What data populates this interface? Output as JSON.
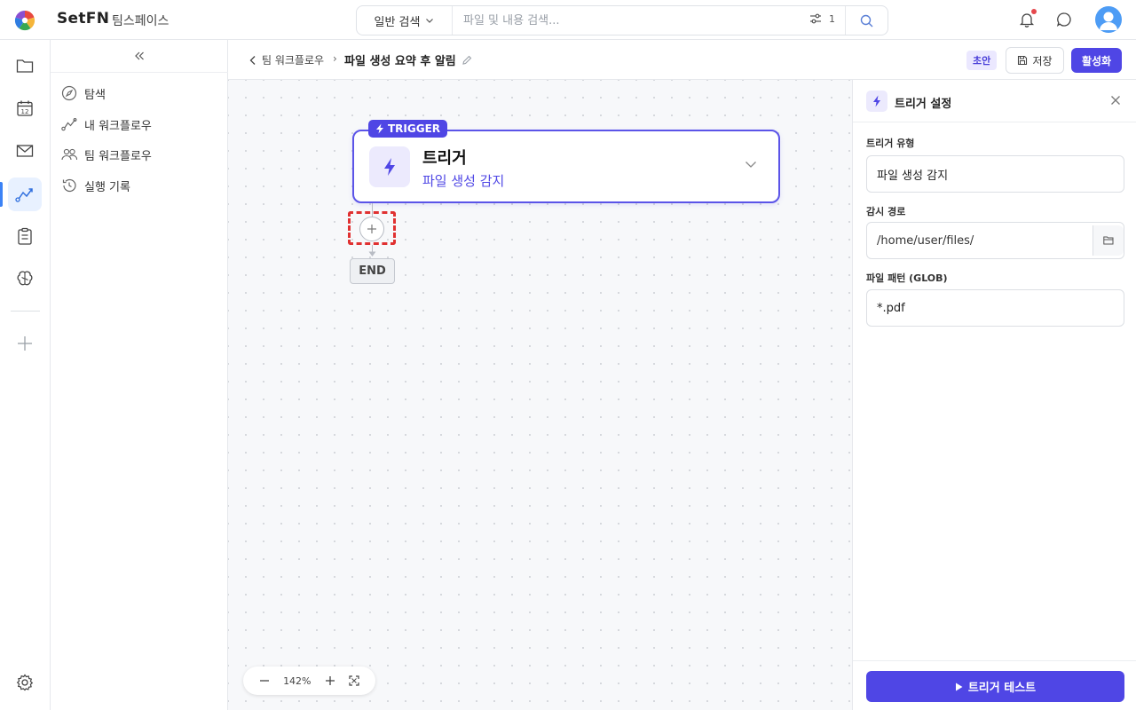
{
  "header": {
    "brand": "SetFN",
    "workspace": "팀스페이스",
    "search": {
      "mode_label": "일반 검색",
      "placeholder": "파일 및 내용 검색...",
      "filter_count": "1"
    }
  },
  "rail": {
    "items": [
      "folder-icon",
      "calendar-icon",
      "mail-icon",
      "workflow-icon",
      "clipboard-icon",
      "brain-icon",
      "plus-icon",
      "gear-icon"
    ],
    "calendar_day": "12",
    "active": "workflow-icon"
  },
  "sidenav": {
    "items": [
      {
        "label": "탐색",
        "icon": "compass-icon"
      },
      {
        "label": "내 워크플로우",
        "icon": "workflow-icon"
      },
      {
        "label": "팀 워크플로우",
        "icon": "team-icon"
      },
      {
        "label": "실행 기록",
        "icon": "history-icon"
      }
    ]
  },
  "breadcrumb": {
    "parent": "팀 워크플로우",
    "separator": "›",
    "current": "파일 생성 요약 후 알림"
  },
  "toolbar": {
    "status_badge": "초안",
    "save_label": "저장",
    "activate_label": "활성화"
  },
  "canvas": {
    "trigger_tag": "TRIGGER",
    "node_title": "트리거",
    "node_subtitle": "파일 생성 감지",
    "end_label": "END",
    "zoom_level": "142%"
  },
  "panel": {
    "title": "트리거 설정",
    "fields": [
      {
        "label": "트리거 유형",
        "value": "파일 생성 감지"
      },
      {
        "label": "감시 경로",
        "value": "/home/user/files/"
      },
      {
        "label": "파일 패턴 (GLOB)",
        "value": "*.pdf"
      }
    ],
    "test_button": "트리거 테스트"
  },
  "colors": {
    "accent": "#4f46e5",
    "active_rail": "#3b82f6",
    "highlight_dashed": "#e03131"
  }
}
